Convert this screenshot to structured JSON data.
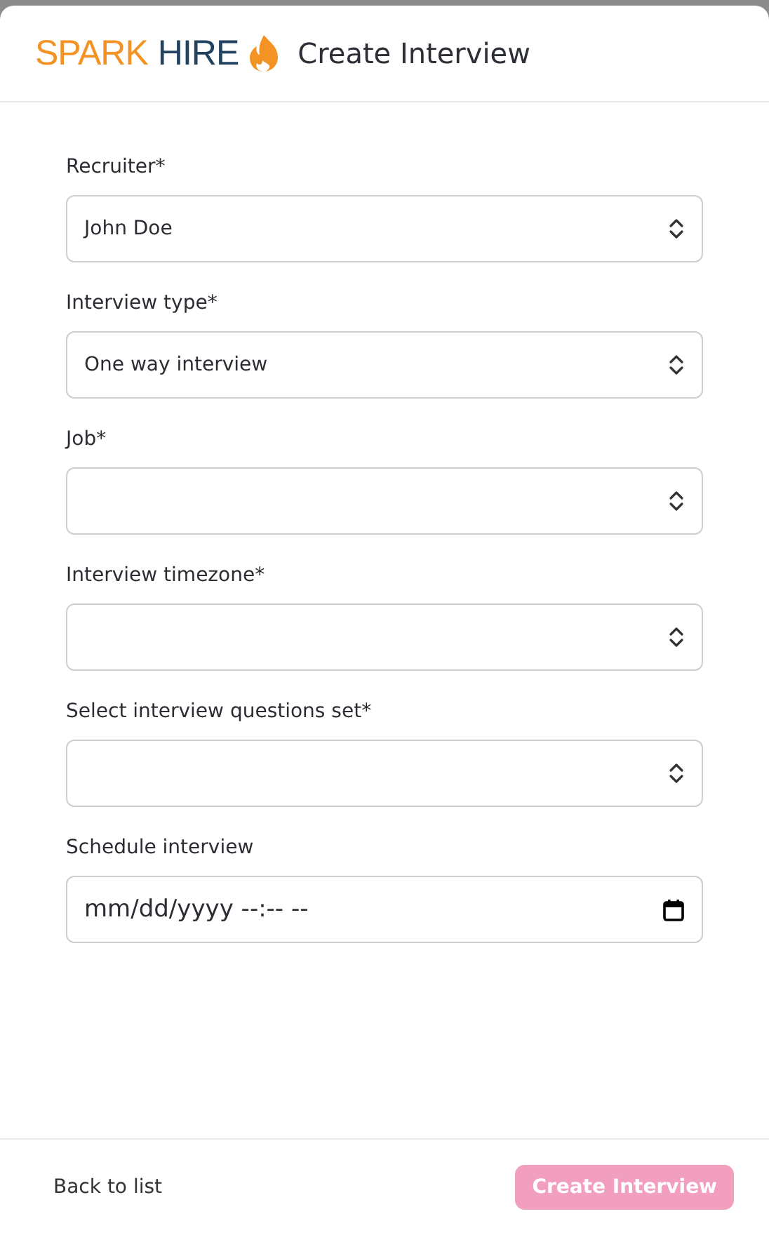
{
  "header": {
    "brand_first": "SPARK",
    "brand_second": "HIRE",
    "title": "Create Interview"
  },
  "fields": [
    {
      "label": "Recruiter*",
      "kind": "select",
      "value": "John Doe"
    },
    {
      "label": "Interview type*",
      "kind": "select",
      "value": "One way interview"
    },
    {
      "label": "Job*",
      "kind": "select"
    },
    {
      "label": "Interview timezone*",
      "kind": "select"
    },
    {
      "label": "Select interview questions set*",
      "kind": "select"
    },
    {
      "label": "Schedule interview",
      "kind": "datetime",
      "value": "mm/dd/yyyy --:-- --"
    }
  ],
  "footer": {
    "back_link": "Back to list",
    "submit": {
      "label": "Create Interview",
      "disabled": true
    }
  }
}
